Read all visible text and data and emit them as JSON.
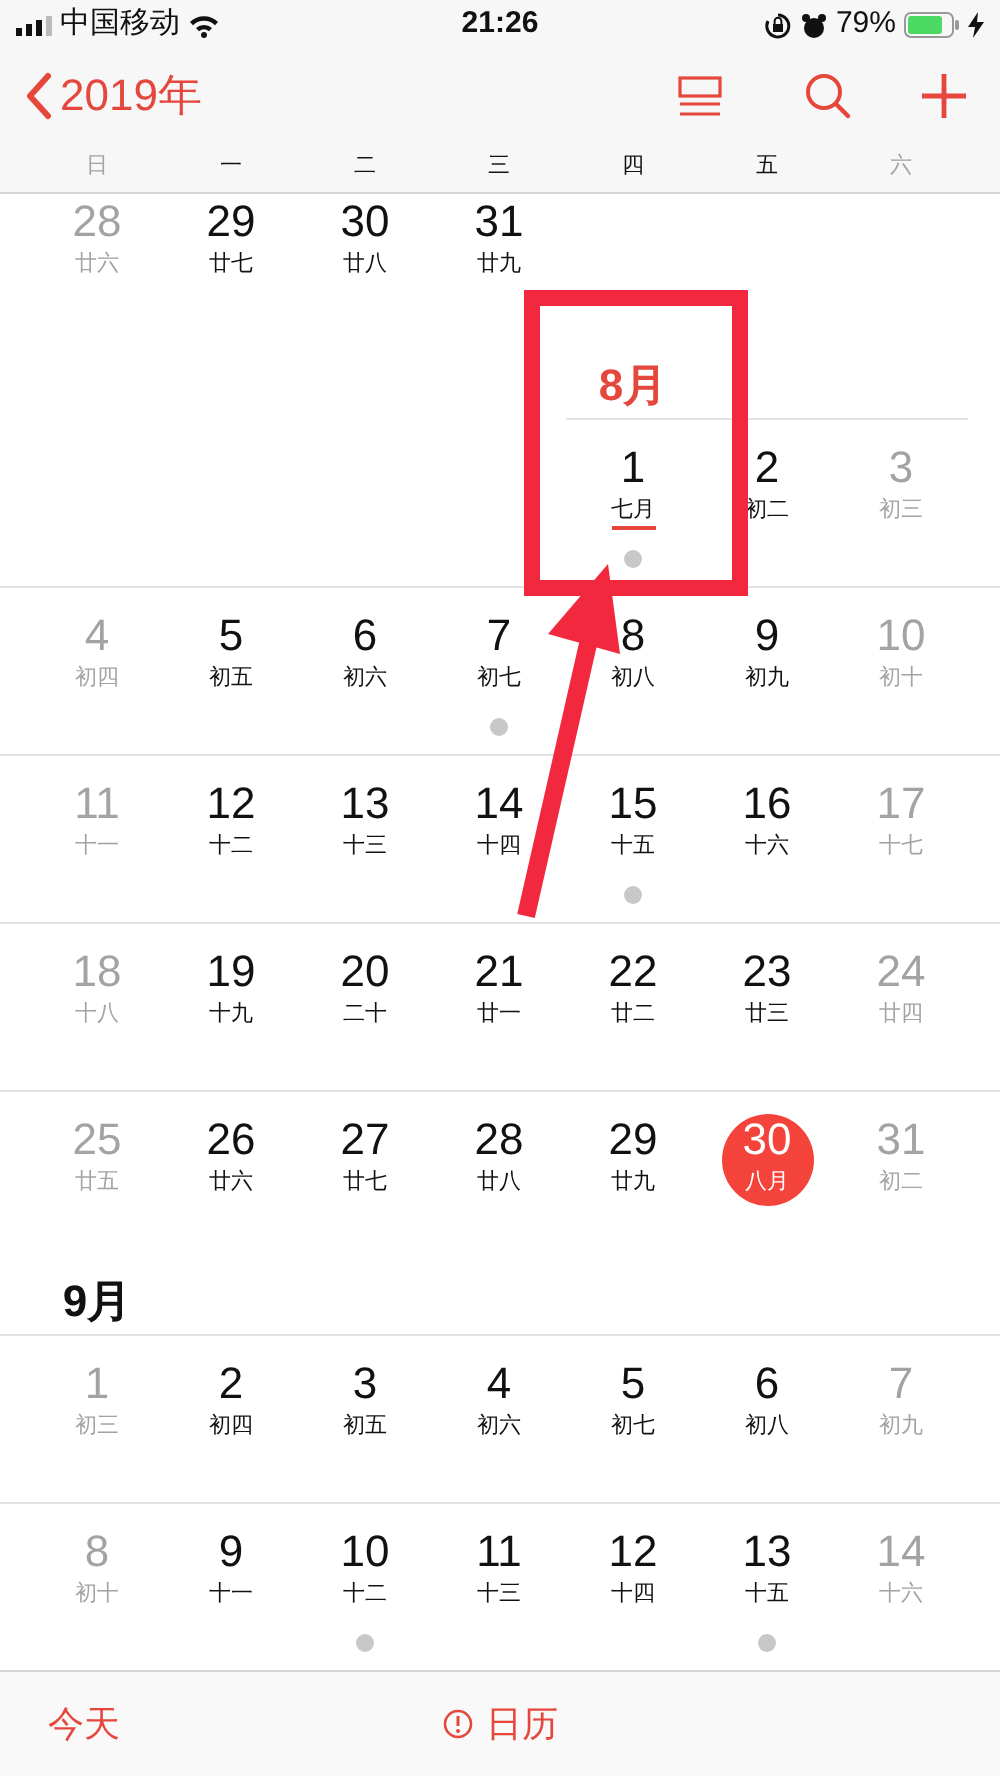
{
  "status_bar": {
    "carrier": "中国移动",
    "time": "21:26",
    "battery": "79%"
  },
  "nav": {
    "back": "2019年"
  },
  "weekdays": [
    {
      "label": "日",
      "weekend": true
    },
    {
      "label": "一",
      "weekend": false
    },
    {
      "label": "二",
      "weekend": false
    },
    {
      "label": "三",
      "weekend": false
    },
    {
      "label": "四",
      "weekend": false
    },
    {
      "label": "五",
      "weekend": false
    },
    {
      "label": "六",
      "weekend": true
    }
  ],
  "months": [
    {
      "weeks": [
        {
          "days": [
            {
              "kind": "day",
              "day": "28",
              "lunar": "廿六",
              "weekend": true,
              "event": false,
              "today": false,
              "underlined": false
            },
            {
              "kind": "day",
              "day": "29",
              "lunar": "廿七",
              "weekend": false,
              "event": false,
              "today": false,
              "underlined": false
            },
            {
              "kind": "day",
              "day": "30",
              "lunar": "廿八",
              "weekend": false,
              "event": false,
              "today": false,
              "underlined": false
            },
            {
              "kind": "day",
              "day": "31",
              "lunar": "廿九",
              "weekend": false,
              "event": false,
              "today": false,
              "underlined": false
            },
            {
              "kind": "blank"
            },
            {
              "kind": "blank"
            },
            {
              "kind": "blank"
            }
          ]
        }
      ]
    },
    {
      "title": "8月",
      "current": true,
      "weeks": [
        {
          "days": [
            {
              "kind": "blank"
            },
            {
              "kind": "blank"
            },
            {
              "kind": "blank"
            },
            {
              "kind": "blank"
            },
            {
              "kind": "day",
              "day": "1",
              "lunar": "七月",
              "weekend": false,
              "event": true,
              "today": false,
              "underlined": true
            },
            {
              "kind": "day",
              "day": "2",
              "lunar": "初二",
              "weekend": false,
              "event": false,
              "today": false,
              "underlined": false
            },
            {
              "kind": "day",
              "day": "3",
              "lunar": "初三",
              "weekend": true,
              "event": false,
              "today": false,
              "underlined": false
            }
          ]
        },
        {
          "days": [
            {
              "kind": "day",
              "day": "4",
              "lunar": "初四",
              "weekend": true,
              "event": false,
              "today": false,
              "underlined": false
            },
            {
              "kind": "day",
              "day": "5",
              "lunar": "初五",
              "weekend": false,
              "event": false,
              "today": false,
              "underlined": false
            },
            {
              "kind": "day",
              "day": "6",
              "lunar": "初六",
              "weekend": false,
              "event": false,
              "today": false,
              "underlined": false
            },
            {
              "kind": "day",
              "day": "7",
              "lunar": "初七",
              "weekend": false,
              "event": true,
              "today": false,
              "underlined": false
            },
            {
              "kind": "day",
              "day": "8",
              "lunar": "初八",
              "weekend": false,
              "event": false,
              "today": false,
              "underlined": false
            },
            {
              "kind": "day",
              "day": "9",
              "lunar": "初九",
              "weekend": false,
              "event": false,
              "today": false,
              "underlined": false
            },
            {
              "kind": "day",
              "day": "10",
              "lunar": "初十",
              "weekend": true,
              "event": false,
              "today": false,
              "underlined": false
            }
          ]
        },
        {
          "days": [
            {
              "kind": "day",
              "day": "11",
              "lunar": "十一",
              "weekend": true,
              "event": false,
              "today": false,
              "underlined": false
            },
            {
              "kind": "day",
              "day": "12",
              "lunar": "十二",
              "weekend": false,
              "event": false,
              "today": false,
              "underlined": false
            },
            {
              "kind": "day",
              "day": "13",
              "lunar": "十三",
              "weekend": false,
              "event": false,
              "today": false,
              "underlined": false
            },
            {
              "kind": "day",
              "day": "14",
              "lunar": "十四",
              "weekend": false,
              "event": false,
              "today": false,
              "underlined": false
            },
            {
              "kind": "day",
              "day": "15",
              "lunar": "十五",
              "weekend": false,
              "event": true,
              "today": false,
              "underlined": false
            },
            {
              "kind": "day",
              "day": "16",
              "lunar": "十六",
              "weekend": false,
              "event": false,
              "today": false,
              "underlined": false
            },
            {
              "kind": "day",
              "day": "17",
              "lunar": "十七",
              "weekend": true,
              "event": false,
              "today": false,
              "underlined": false
            }
          ]
        },
        {
          "days": [
            {
              "kind": "day",
              "day": "18",
              "lunar": "十八",
              "weekend": true,
              "event": false,
              "today": false,
              "underlined": false
            },
            {
              "kind": "day",
              "day": "19",
              "lunar": "十九",
              "weekend": false,
              "event": false,
              "today": false,
              "underlined": false
            },
            {
              "kind": "day",
              "day": "20",
              "lunar": "二十",
              "weekend": false,
              "event": false,
              "today": false,
              "underlined": false
            },
            {
              "kind": "day",
              "day": "21",
              "lunar": "廿一",
              "weekend": false,
              "event": false,
              "today": false,
              "underlined": false
            },
            {
              "kind": "day",
              "day": "22",
              "lunar": "廿二",
              "weekend": false,
              "event": false,
              "today": false,
              "underlined": false
            },
            {
              "kind": "day",
              "day": "23",
              "lunar": "廿三",
              "weekend": false,
              "event": false,
              "today": false,
              "underlined": false
            },
            {
              "kind": "day",
              "day": "24",
              "lunar": "廿四",
              "weekend": true,
              "event": false,
              "today": false,
              "underlined": false
            }
          ]
        },
        {
          "days": [
            {
              "kind": "day",
              "day": "25",
              "lunar": "廿五",
              "weekend": true,
              "event": false,
              "today": false,
              "underlined": false
            },
            {
              "kind": "day",
              "day": "26",
              "lunar": "廿六",
              "weekend": false,
              "event": false,
              "today": false,
              "underlined": false
            },
            {
              "kind": "day",
              "day": "27",
              "lunar": "廿七",
              "weekend": false,
              "event": false,
              "today": false,
              "underlined": false
            },
            {
              "kind": "day",
              "day": "28",
              "lunar": "廿八",
              "weekend": false,
              "event": false,
              "today": false,
              "underlined": false
            },
            {
              "kind": "day",
              "day": "29",
              "lunar": "廿九",
              "weekend": false,
              "event": false,
              "today": false,
              "underlined": false
            },
            {
              "kind": "day",
              "day": "30",
              "lunar": "八月",
              "weekend": false,
              "event": false,
              "today": true,
              "underlined": false
            },
            {
              "kind": "day",
              "day": "31",
              "lunar": "初二",
              "weekend": true,
              "event": false,
              "today": false,
              "underlined": false
            }
          ]
        }
      ]
    },
    {
      "title": "9月",
      "current": false,
      "weeks": [
        {
          "days": [
            {
              "kind": "day",
              "day": "1",
              "lunar": "初三",
              "weekend": true,
              "event": false,
              "today": false,
              "underlined": false
            },
            {
              "kind": "day",
              "day": "2",
              "lunar": "初四",
              "weekend": false,
              "event": false,
              "today": false,
              "underlined": false
            },
            {
              "kind": "day",
              "day": "3",
              "lunar": "初五",
              "weekend": false,
              "event": false,
              "today": false,
              "underlined": false
            },
            {
              "kind": "day",
              "day": "4",
              "lunar": "初六",
              "weekend": false,
              "event": false,
              "today": false,
              "underlined": false
            },
            {
              "kind": "day",
              "day": "5",
              "lunar": "初七",
              "weekend": false,
              "event": false,
              "today": false,
              "underlined": false
            },
            {
              "kind": "day",
              "day": "6",
              "lunar": "初八",
              "weekend": false,
              "event": false,
              "today": false,
              "underlined": false
            },
            {
              "kind": "day",
              "day": "7",
              "lunar": "初九",
              "weekend": true,
              "event": false,
              "today": false,
              "underlined": false
            }
          ]
        },
        {
          "days": [
            {
              "kind": "day",
              "day": "8",
              "lunar": "初十",
              "weekend": true,
              "event": false,
              "today": false,
              "underlined": false
            },
            {
              "kind": "day",
              "day": "9",
              "lunar": "十一",
              "weekend": false,
              "event": false,
              "today": false,
              "underlined": false
            },
            {
              "kind": "day",
              "day": "10",
              "lunar": "十二",
              "weekend": false,
              "event": true,
              "today": false,
              "underlined": false
            },
            {
              "kind": "day",
              "day": "11",
              "lunar": "十三",
              "weekend": false,
              "event": false,
              "today": false,
              "underlined": false
            },
            {
              "kind": "day",
              "day": "12",
              "lunar": "十四",
              "weekend": false,
              "event": false,
              "today": false,
              "underlined": false
            },
            {
              "kind": "day",
              "day": "13",
              "lunar": "十五",
              "weekend": false,
              "event": true,
              "today": false,
              "underlined": false
            },
            {
              "kind": "day",
              "day": "14",
              "lunar": "十六",
              "weekend": true,
              "event": false,
              "today": false,
              "underlined": false
            }
          ]
        }
      ]
    }
  ],
  "tab_bar": [
    {
      "label": "今天",
      "kind": "text"
    },
    {
      "label": "日历",
      "kind": "alert"
    }
  ],
  "annotation": {
    "box": true,
    "arrow": true
  }
}
